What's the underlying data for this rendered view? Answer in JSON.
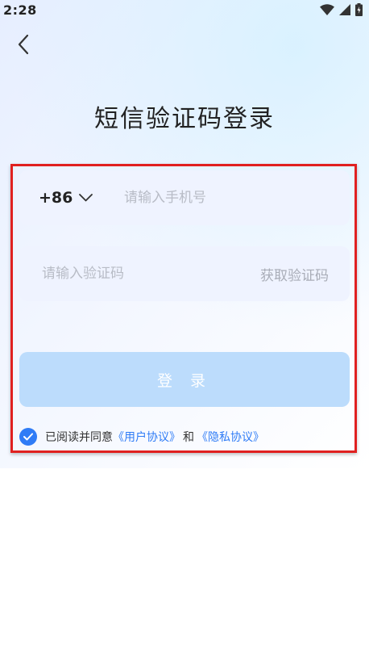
{
  "status_bar": {
    "time": "2:28"
  },
  "header": {
    "title": "短信验证码登录"
  },
  "form": {
    "country_code": "+86",
    "phone_placeholder": "请输入手机号",
    "code_placeholder": "请输入验证码",
    "get_code_label": "获取验证码",
    "login_label": "登 录"
  },
  "agreement": {
    "prefix": "已阅读并同意",
    "user_agreement": "《用户协议》",
    "and": "和",
    "privacy_policy": "《隐私协议》",
    "checked": true
  },
  "colors": {
    "accent": "#2f7cf6",
    "login_button_disabled": "#bcdcfc",
    "field_background": "#eff3ff",
    "highlight_border": "#e02020"
  }
}
